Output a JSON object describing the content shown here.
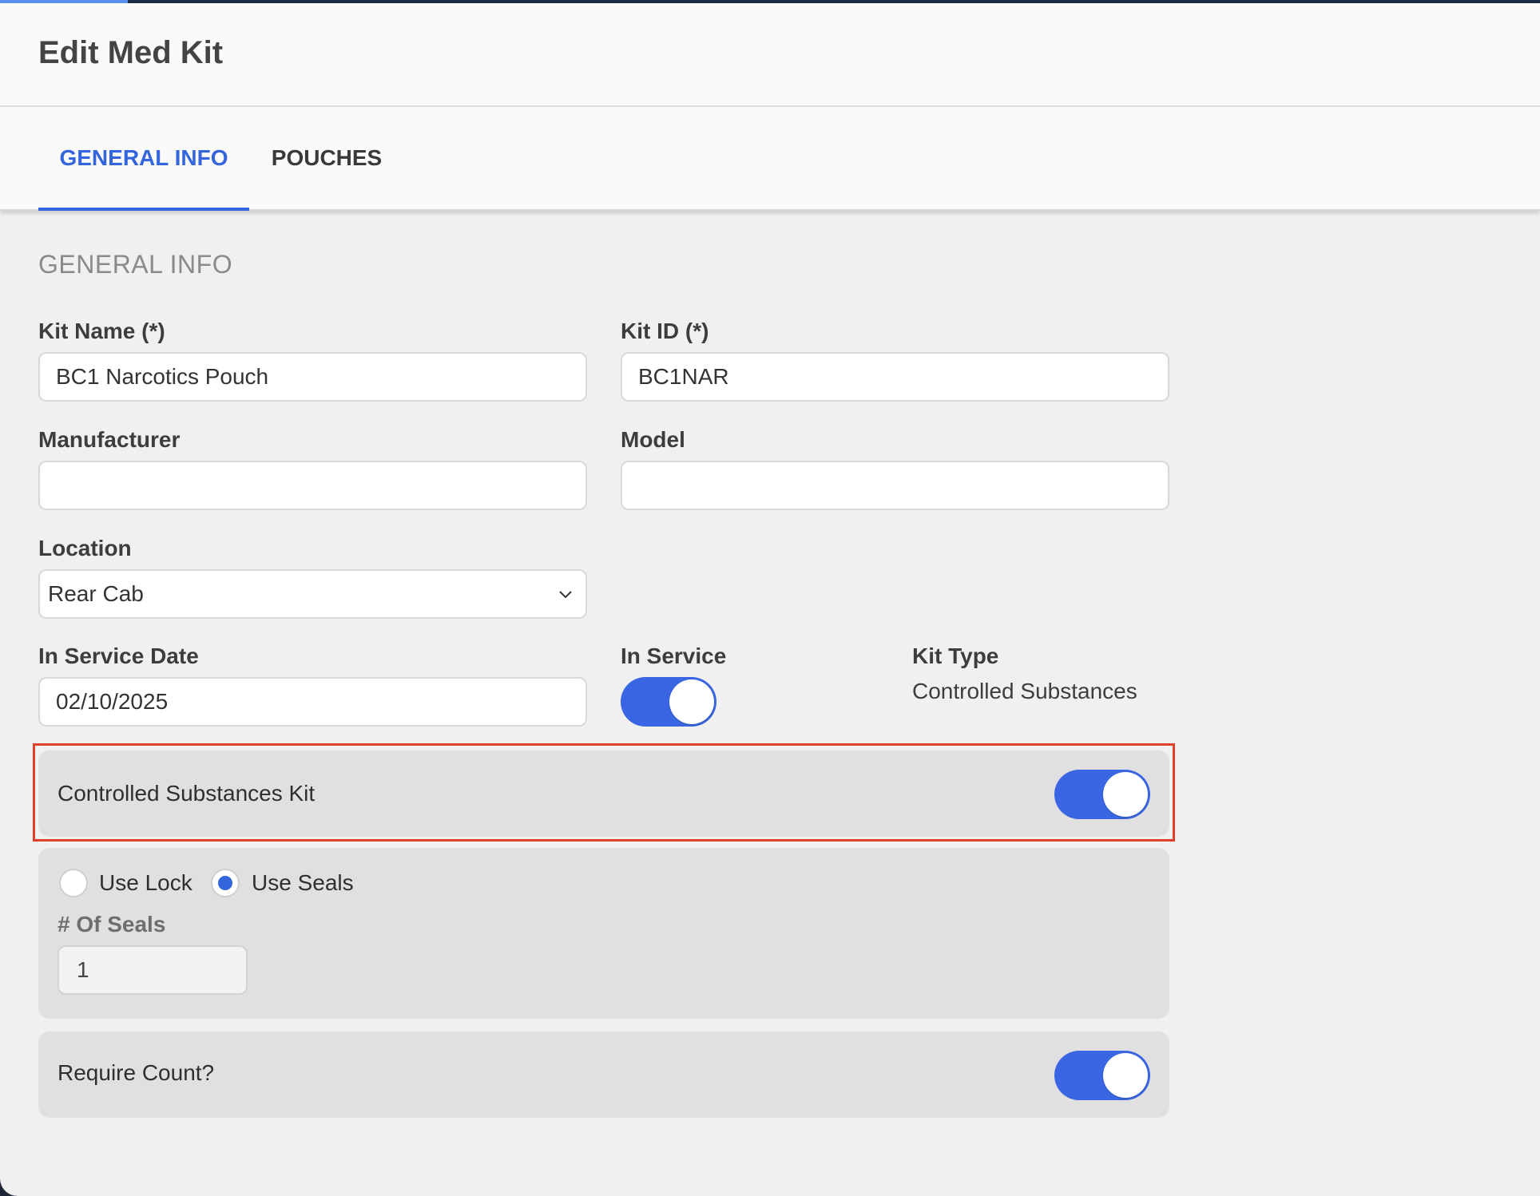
{
  "page": {
    "title": "Edit Med Kit"
  },
  "tabs": [
    {
      "label": "GENERAL INFO",
      "active": true
    },
    {
      "label": "POUCHES",
      "active": false
    }
  ],
  "section": {
    "title": "GENERAL INFO"
  },
  "form": {
    "kit_name": {
      "label": "Kit Name (*)",
      "value": "BC1 Narcotics Pouch"
    },
    "kit_id": {
      "label": "Kit ID (*)",
      "value": "BC1NAR"
    },
    "manufacturer": {
      "label": "Manufacturer",
      "value": ""
    },
    "model": {
      "label": "Model",
      "value": ""
    },
    "location": {
      "label": "Location",
      "value": "Rear Cab"
    },
    "in_service_date": {
      "label": "In Service Date",
      "value": "02/10/2025"
    },
    "in_service": {
      "label": "In Service",
      "on": true
    },
    "kit_type": {
      "label": "Kit Type",
      "value": "Controlled Substances"
    }
  },
  "controlled_substances": {
    "label": "Controlled Substances Kit",
    "on": true
  },
  "seal_options": {
    "use_lock": {
      "label": "Use Lock",
      "checked": false
    },
    "use_seals": {
      "label": "Use Seals",
      "checked": true
    },
    "num_seals": {
      "label": "# Of Seals",
      "value": "1"
    }
  },
  "require_count": {
    "label": "Require Count?",
    "on": true
  },
  "colors": {
    "accent": "#3366dd",
    "toggle_on": "#3a66e3",
    "highlight": "#e0402a"
  }
}
